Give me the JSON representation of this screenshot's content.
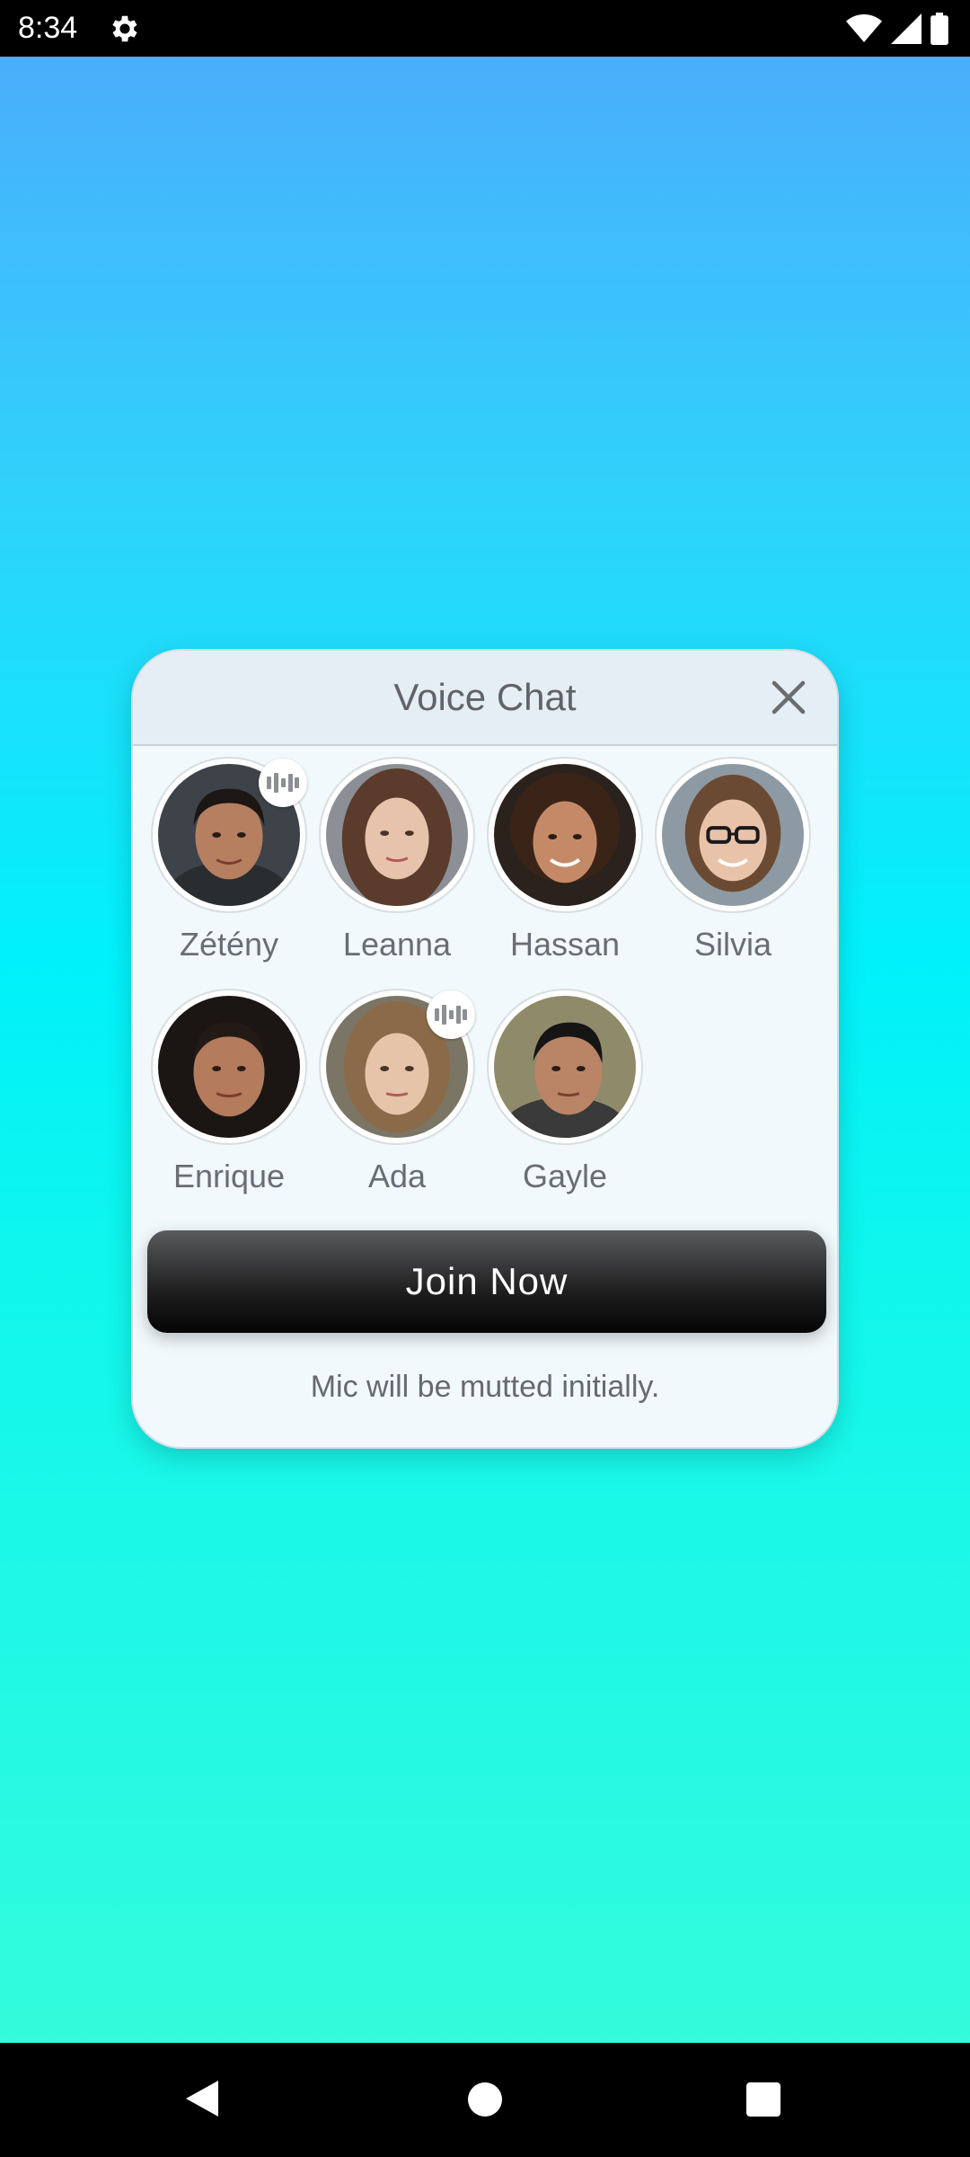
{
  "status_bar": {
    "time": "8:34",
    "icons": [
      "settings-icon",
      "wifi-icon",
      "signal-icon",
      "battery-icon"
    ]
  },
  "dialog": {
    "title": "Voice Chat",
    "close_icon": "close-icon",
    "participants": [
      {
        "name": "Zétény",
        "speaking": true
      },
      {
        "name": "Leanna",
        "speaking": false
      },
      {
        "name": "Hassan",
        "speaking": false
      },
      {
        "name": "Silvia",
        "speaking": false
      },
      {
        "name": "Enrique",
        "speaking": false
      },
      {
        "name": "Ada",
        "speaking": true
      },
      {
        "name": "Gayle",
        "speaking": false
      }
    ],
    "join_label": "Join Now",
    "mic_note": "Mic will be mutted initially."
  },
  "colors": {
    "gradient_top": "#4aaefc",
    "gradient_mid": "#00f1fb",
    "gradient_bottom": "#33fbdc",
    "dialog_bg": "#f1f9fd",
    "button_dark": "#050505"
  },
  "nav_bar": {
    "icons": [
      "back-icon",
      "home-icon",
      "recent-apps-icon"
    ]
  }
}
